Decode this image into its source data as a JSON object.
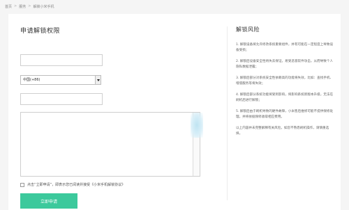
{
  "breadcrumb": [
    "首页",
    "服务",
    "解锁小米手机"
  ],
  "form": {
    "title": "申请解锁权限",
    "country_code_value": "中国(+86)",
    "agreement_text": "点击“立即申请”，即表示您已阅读并接受《小米手机解锁协议》",
    "submit_label": "立即申请"
  },
  "risks": {
    "title": "解锁风险",
    "items": [
      "1. 解锁设备将允许修改系统重要组件，并有可能在一定程度上导致设备受损；",
      "2. 解锁后设备安全性将失去保证，易受恶意软件攻击，从而导致个人隐私数据泄露；",
      "3. 解锁后部分对系统安全性依赖高的功能将失效，比如：查找手机、增值服务等将失效；",
      "4. 解锁后部分系统功能将受到影响，将影响系统新版本升级，无法在刷机后进行解锁；",
      "5. 解锁后由于刷机导致的硬件故障，小米售后维修可能不提供保修处理，并将依据保修收取相应费用。",
      "以上内容并未完整解释有关风险，如您不熟悉刷机操作，请慎重选择。"
    ]
  }
}
